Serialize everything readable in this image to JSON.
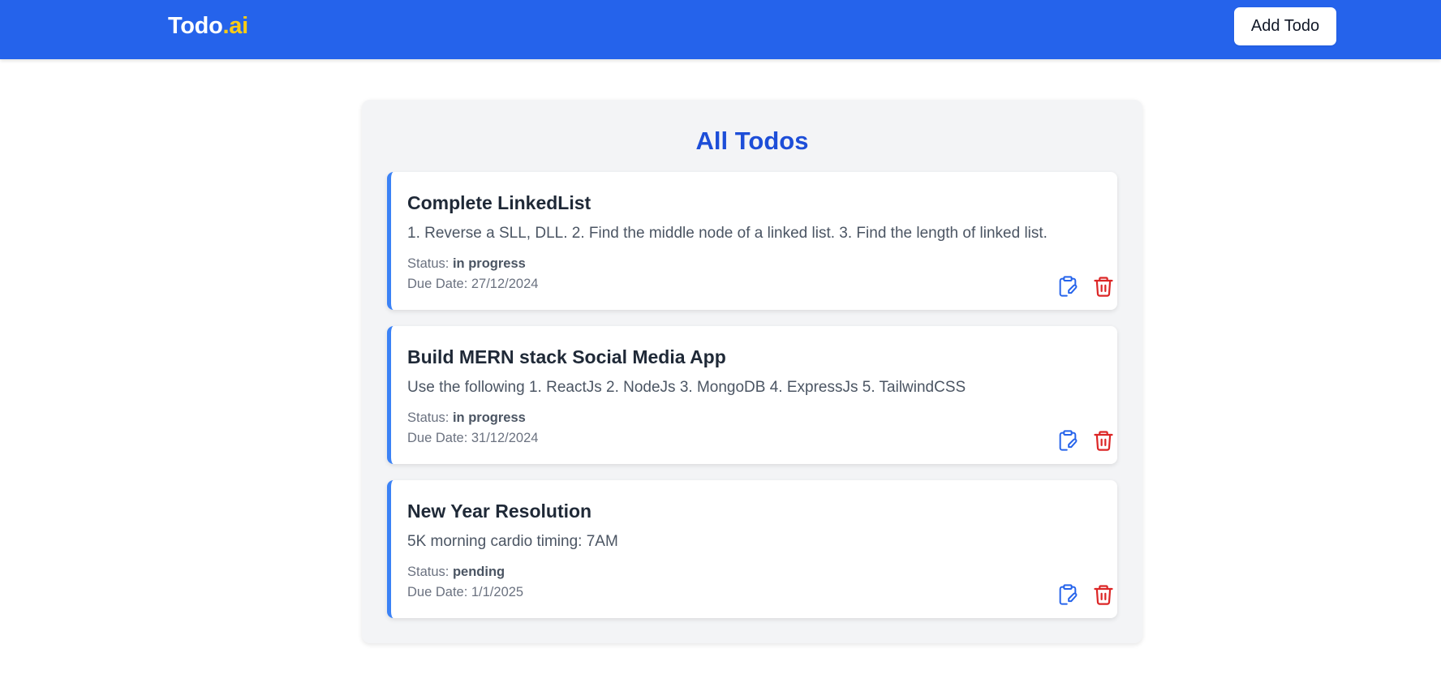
{
  "navbar": {
    "brand_main": "Todo",
    "brand_accent": ".ai",
    "add_button_label": "Add Todo"
  },
  "page": {
    "title": "All Todos"
  },
  "colors": {
    "primary": "#2563eb",
    "accent": "#facc15",
    "title_blue": "#1d4ed8",
    "delete_red": "#dc2626"
  },
  "labels": {
    "status": "Status: ",
    "due_date": "Due Date: "
  },
  "todos": [
    {
      "title": "Complete LinkedList",
      "description": "1. Reverse a SLL, DLL. 2. Find the middle node of a linked list. 3. Find the length of linked list.",
      "status": "in progress",
      "due_date": "27/12/2024"
    },
    {
      "title": "Build MERN stack Social Media App",
      "description": "Use the following 1. ReactJs 2. NodeJs 3. MongoDB 4. ExpressJs 5. TailwindCSS",
      "status": "in progress",
      "due_date": "31/12/2024"
    },
    {
      "title": "New Year Resolution",
      "description": "5K morning cardio timing: 7AM",
      "status": "pending",
      "due_date": "1/1/2025"
    }
  ],
  "icons": {
    "edit": "clipboard-edit-icon",
    "delete": "trash-icon"
  }
}
